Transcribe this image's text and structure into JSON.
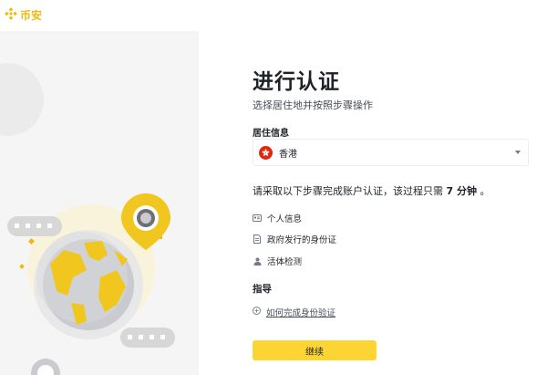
{
  "brand": {
    "name": "币安"
  },
  "page": {
    "title": "进行认证",
    "subtitle": "选择居住地并按照步骤操作"
  },
  "residence": {
    "label": "居住信息",
    "selected": "香港"
  },
  "instruction": {
    "prefix": "请采取以下步骤完成账户认证，该过程只需 ",
    "duration": "7 分钟",
    "suffix": " 。"
  },
  "steps": [
    {
      "label": "个人信息",
      "icon": "id-card-icon"
    },
    {
      "label": "政府发行的身份证",
      "icon": "document-icon"
    },
    {
      "label": "活体检测",
      "icon": "person-icon"
    }
  ],
  "guide": {
    "label": "指导",
    "link": "如何完成身份验证"
  },
  "actions": {
    "continue": "继续"
  },
  "colors": {
    "brand": "#f0b90b",
    "button": "#fcd535",
    "flag": "#de2910"
  }
}
